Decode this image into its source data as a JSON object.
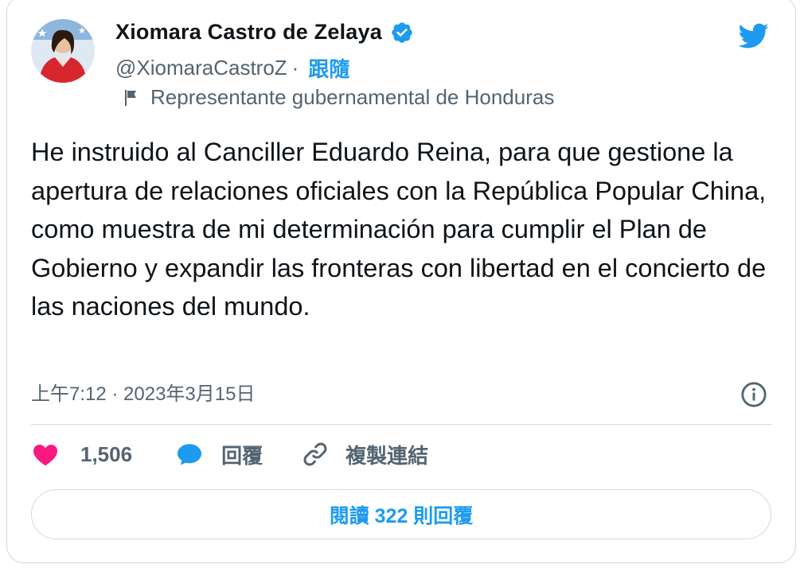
{
  "author": {
    "name": "Xiomara Castro de Zelaya",
    "handle": "@XiomaraCastroZ",
    "follow_label": "跟隨",
    "separator": "·",
    "account_label": "Representante gubernamental de Honduras",
    "verified": true
  },
  "tweet": {
    "text": "He instruido al Canciller Eduardo Reina, para que gestione la apertura de relaciones oficiales con la República Popular China, como muestra de mi determinación para cumplir el Plan de Gobierno y expandir las fronteras con libertad en el concierto de las naciones del mundo.",
    "timestamp": "上午7:12 · 2023年3月15日"
  },
  "actions": {
    "likes": "1,506",
    "reply_label": "回覆",
    "copy_link_label": "複製連結"
  },
  "read_replies_label": "閱讀 322 則回覆",
  "icons": {
    "verified": "verified-badge-icon",
    "bird": "twitter-bird-icon",
    "flag": "flag-icon",
    "info": "info-icon",
    "heart": "heart-icon",
    "reply": "reply-bubble-icon",
    "link": "link-icon"
  },
  "colors": {
    "brand_blue": "#1d9bf0",
    "heart_pink": "#f91880",
    "text_primary": "#0f1419",
    "text_secondary": "#536471",
    "border": "#cfd9de"
  }
}
